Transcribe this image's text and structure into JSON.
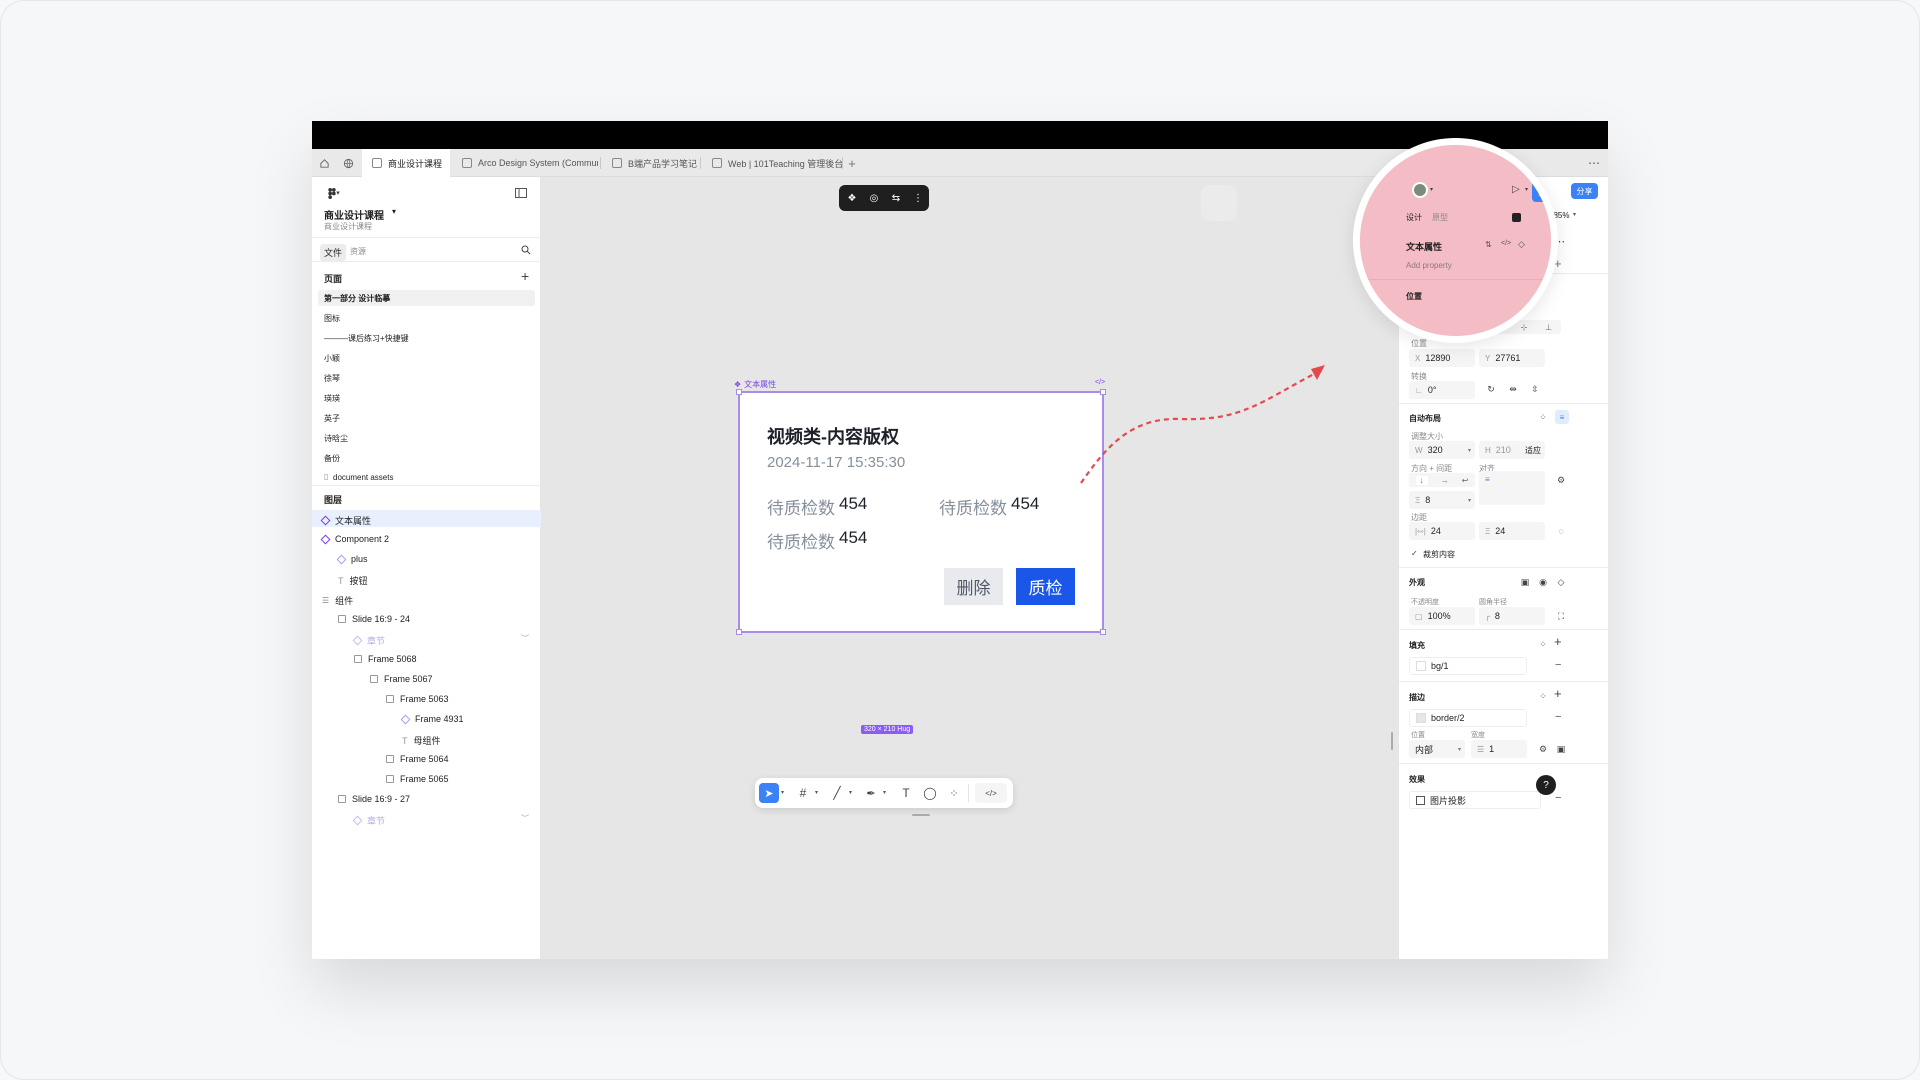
{
  "tabs": [
    {
      "label": "商业设计课程",
      "active": true
    },
    {
      "label": "Arco Design System (Community) (C",
      "active": false
    },
    {
      "label": "B端产品学习笔记",
      "active": false
    },
    {
      "label": "Web | 101Teaching 管理後台",
      "active": false
    }
  ],
  "left": {
    "project_title": "商业设计课程",
    "project_sub": "商业设计课程",
    "file_tab": "文件",
    "assets_tab": "资源",
    "pages_heading": "页面",
    "pages": [
      "第一部分 设计临摹",
      "图标",
      "———课后练习+快捷键",
      "小颖",
      "徐琴",
      "瑛瑛",
      "英子",
      "诗晗尘",
      "备份",
      "document assets"
    ],
    "layers_heading": "图层",
    "layers": [
      {
        "label": "文本属性"
      },
      {
        "label": "Component 2"
      },
      {
        "label": "plus"
      },
      {
        "label": "按钮"
      },
      {
        "label": "组件"
      },
      {
        "label": "Slide 16:9 - 24"
      },
      {
        "label": "章节"
      },
      {
        "label": "Frame 5068"
      },
      {
        "label": "Frame 5067"
      },
      {
        "label": "Frame 5063"
      },
      {
        "label": "Frame 4931"
      },
      {
        "label": "母组件"
      },
      {
        "label": "Frame 5064"
      },
      {
        "label": "Frame 5065"
      },
      {
        "label": "Slide 16:9 - 27"
      },
      {
        "label": "章节"
      }
    ]
  },
  "canvas": {
    "component_label": "文本属性",
    "card_title": "视频类-内容版权",
    "card_time": "2024-11-17 15:35:30",
    "fields": [
      {
        "label": "待质检数",
        "value": "454"
      },
      {
        "label": "待质检数",
        "value": "454"
      },
      {
        "label": "待质检数",
        "value": "454"
      }
    ],
    "delete_button": "删除",
    "qc_button": "质检",
    "size_badge": "320 × 210 Hug"
  },
  "right": {
    "share_button": "分享",
    "design_tab": "设计",
    "prototype_tab": "原型",
    "zoom": "185%",
    "text_props_heading": "文本属性",
    "add_property": "Add property",
    "position_heading": "位置",
    "align_label": "对齐",
    "pos_label": "位置",
    "x_label": "X",
    "x_value": "12890",
    "y_label": "Y",
    "y_value": "27761",
    "transform_label": "转换",
    "rotation": "0°",
    "autolayout_heading": "自动布局",
    "resize_label": "调整大小",
    "w_label": "W",
    "w_value": "320",
    "h_label": "H",
    "h_value": "210",
    "h_mode": "适应",
    "direction_label": "方向 + 间距",
    "align2_label": "对齐",
    "gap_value": "8",
    "padding_label": "边距",
    "pad_h": "24",
    "pad_v": "24",
    "clip_label": "裁剪内容",
    "appearance_heading": "外观",
    "opacity_label": "不透明度",
    "opacity_value": "100%",
    "radius_label": "圆角半径",
    "radius_value": "8",
    "fill_heading": "填充",
    "fill_value": "bg/1",
    "stroke_heading": "描边",
    "stroke_value": "border/2",
    "stroke_pos_label": "位置",
    "stroke_weight_label": "宽度",
    "stroke_pos": "内部",
    "stroke_weight": "1",
    "effects_heading": "效果",
    "effect_value": "图片投影",
    "help": "?"
  },
  "colors": {
    "accent": "#1a56e8",
    "purple": "#7b3fe4",
    "share": "#3b82f6",
    "arrow": "#e5484d",
    "magnifier": "#f2c2c8"
  }
}
